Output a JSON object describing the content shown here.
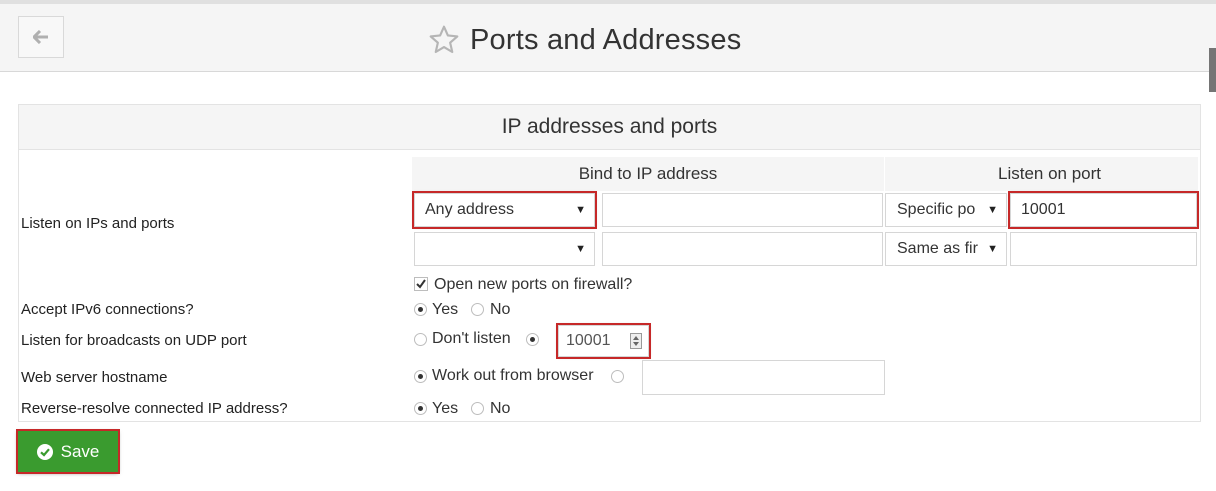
{
  "header": {
    "title": "Ports and Addresses"
  },
  "panel": {
    "title": "IP addresses and ports",
    "labels": {
      "listen": "Listen on IPs and ports",
      "ipv6": "Accept IPv6 connections?",
      "udp": "Listen for broadcasts on UDP port",
      "hostname": "Web server hostname",
      "reverse": "Reverse-resolve connected IP address?"
    },
    "grid": {
      "col_bind": "Bind to IP address",
      "col_port": "Listen on port",
      "rows": [
        {
          "address": "Any address",
          "ip": "",
          "port_mode": "Specific po",
          "port": "10001"
        },
        {
          "address": "",
          "ip": "",
          "port_mode": "Same as fir",
          "port": ""
        }
      ]
    },
    "firewall_label": "Open new ports on firewall?",
    "ipv6": {
      "yes": "Yes",
      "no": "No",
      "selected": "yes"
    },
    "udp": {
      "dont_listen": "Don't listen",
      "port": "10001",
      "selected": "port"
    },
    "hostname": {
      "work_out": "Work out from browser",
      "value": "",
      "selected": "work_out"
    },
    "reverse": {
      "yes": "Yes",
      "no": "No",
      "selected": "yes"
    }
  },
  "save_label": "Save",
  "colors": {
    "save_green": "#3a9b2f",
    "highlight": "#c62828"
  }
}
